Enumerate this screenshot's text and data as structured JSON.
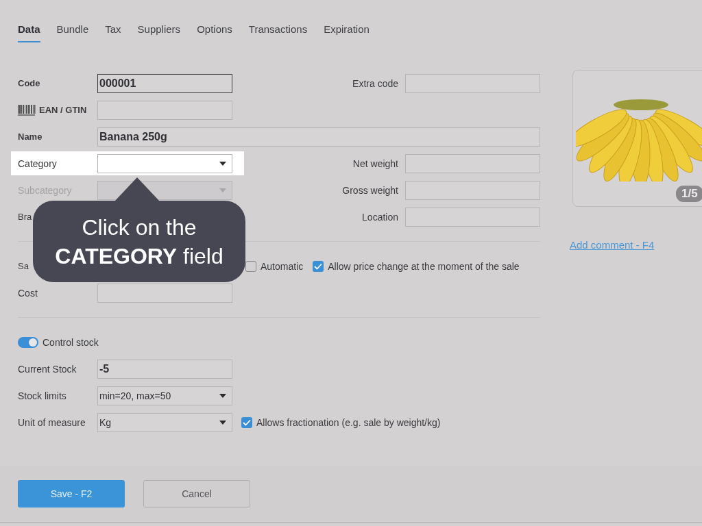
{
  "tabs": [
    {
      "label": "Data",
      "selected": true
    },
    {
      "label": "Bundle",
      "selected": false
    },
    {
      "label": "Tax",
      "selected": false
    },
    {
      "label": "Suppliers",
      "selected": false
    },
    {
      "label": "Options",
      "selected": false
    },
    {
      "label": "Transactions",
      "selected": false
    },
    {
      "label": "Expiration",
      "selected": false
    }
  ],
  "product": {
    "code": {
      "label": "Code",
      "value": "000001"
    },
    "extra_code": {
      "label": "Extra code"
    },
    "ean": {
      "label": "EAN / GTIN"
    },
    "name": {
      "label": "Name",
      "value": "Banana 250g"
    },
    "category": {
      "label": "Category",
      "highlighted": true
    },
    "net_weight": {
      "label": "Net weight"
    },
    "subcategory": {
      "label": "Subcategory",
      "disabled": true
    },
    "gross_weight": {
      "label": "Gross weight"
    },
    "brand": {
      "label": "Bra"
    },
    "location": {
      "label": "Location"
    }
  },
  "pricing": {
    "sale_label": "Sa",
    "automatic": {
      "label": "Automatic",
      "checked": false
    },
    "allow_price_change": {
      "label": "Allow price change at the moment of the sale",
      "checked": true
    },
    "cost": {
      "label": "Cost"
    }
  },
  "stock": {
    "control_stock": {
      "label": "Control stock",
      "on": true
    },
    "current_stock": {
      "label": "Current Stock",
      "value": "-5"
    },
    "stock_limits": {
      "label": "Stock limits",
      "value": "min=20, max=50"
    },
    "unit": {
      "label": "Unit of measure",
      "value": "Kg"
    },
    "fractionation": {
      "label": "Allows fractionation (e.g. sale by weight/kg)",
      "checked": true
    }
  },
  "image": {
    "kind": "picture",
    "counter": "1/5"
  },
  "comment_link": "Add comment - F4",
  "buttons": [
    {
      "label": "Save - F2",
      "kind": "primary"
    },
    {
      "label": "Cancel",
      "kind": "secondary"
    }
  ],
  "callout": {
    "text": "Click on the **CATEGORY** field"
  }
}
